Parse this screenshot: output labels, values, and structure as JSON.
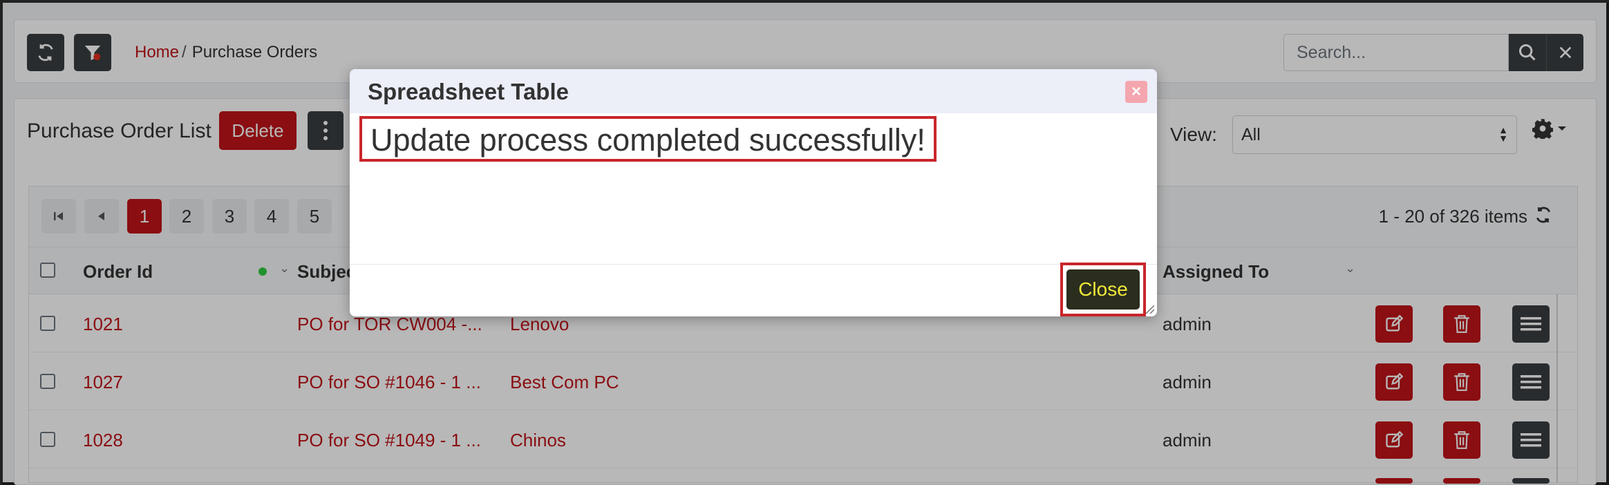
{
  "topbar": {
    "breadcrumb": {
      "home": "Home",
      "separator": "/",
      "current": "Purchase Orders"
    },
    "search": {
      "placeholder": "Search..."
    },
    "icons": [
      "refresh-icon",
      "filter-icon",
      "search-icon",
      "close-icon"
    ]
  },
  "list": {
    "title": "Purchase Order List",
    "delete_label": "Delete",
    "view_label": "View:",
    "view_value": "All"
  },
  "pager": {
    "pages": [
      "1",
      "2",
      "3",
      "4",
      "5"
    ],
    "active_page": "1",
    "items_info": "1 - 20 of 326 items"
  },
  "table": {
    "columns": {
      "order_id": "Order Id",
      "subject": "Subject",
      "assigned_to": "Assigned To"
    },
    "rows": [
      {
        "order_id": "1021",
        "subject": "PO for TOR CW004 -...",
        "vendor": "Lenovo",
        "assigned": "admin"
      },
      {
        "order_id": "1027",
        "subject": "PO for SO #1046 - 1 ...",
        "vendor": "Best Com PC",
        "assigned": "admin"
      },
      {
        "order_id": "1028",
        "subject": "PO for SO #1049 - 1 ...",
        "vendor": "Chinos",
        "assigned": "admin"
      }
    ]
  },
  "modal": {
    "title": "Spreadsheet Table",
    "close_x": "×",
    "message": "Update process completed successfully!",
    "close_label": "Close"
  },
  "colors": {
    "accent": "#c0141a",
    "dark": "#3a3d42",
    "close_text": "#f0e83a",
    "highlight": "#c8262b"
  }
}
